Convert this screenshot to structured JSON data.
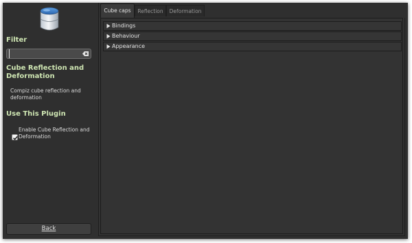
{
  "sidebar": {
    "filter_heading": "Filter",
    "filter_value": "",
    "plugin_title": "Cube Reflection and Deformation",
    "description": "Compiz cube reflection and deformation",
    "use_heading": "Use This Plugin",
    "enable_label": "Enable Cube Reflection and Deformation",
    "enable_checked": true,
    "back_label": "Back",
    "icons": {
      "plugin": "cube-plugin-icon",
      "clear": "clear-field-icon",
      "checkbox": "checkmark-icon"
    }
  },
  "tabs": [
    {
      "label": "Cube caps",
      "active": true
    },
    {
      "label": "Reflection",
      "active": false
    },
    {
      "label": "Deformation",
      "active": false
    }
  ],
  "sections": [
    {
      "label": "Bindings",
      "expanded": false
    },
    {
      "label": "Behaviour",
      "expanded": false
    },
    {
      "label": "Appearance",
      "expanded": false
    }
  ],
  "colors": {
    "window_background": "#2f2f2f",
    "heading": "#cfe6b3",
    "text": "#e4e4e4"
  }
}
